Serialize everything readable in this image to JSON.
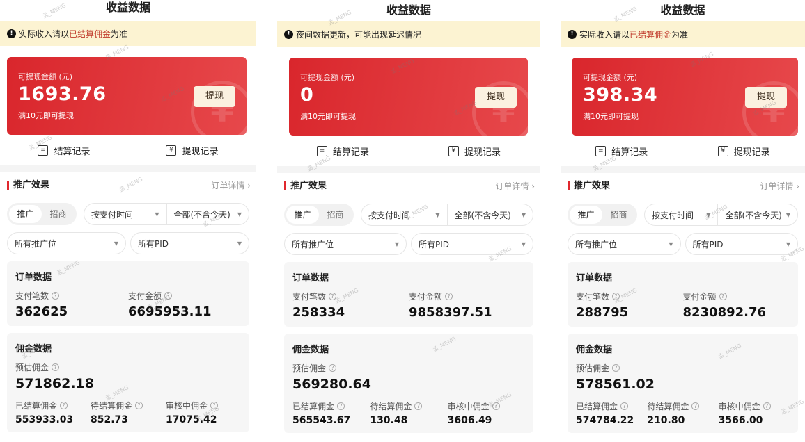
{
  "panels": [
    {
      "title": "收益数据",
      "notice": {
        "prefix": "实际收入请以",
        "highlight": "已结算佣金",
        "suffix": "为准"
      },
      "card": {
        "label": "可提现金额 (元)",
        "amount": "1693.76",
        "note": "满10元即可提现",
        "button": "提现"
      },
      "records": {
        "settle": "结算记录",
        "withdraw": "提现记录"
      },
      "section": {
        "title": "推广效果",
        "link": "订单详情 ›"
      },
      "segments": {
        "promote": "推广",
        "merchant": "招商"
      },
      "time_filter": "按支付时间",
      "range_filter": "全部(不含今天)",
      "position_filter": "所有推广位",
      "pid_filter": "所有PID",
      "orders": {
        "title": "订单数据",
        "count_label": "支付笔数",
        "count": "362625",
        "amount_label": "支付金额",
        "amount": "6695953.11"
      },
      "commission": {
        "title": "佣金数据",
        "est_label": "预估佣金",
        "est": "571862.18",
        "settled_label": "已结算佣金",
        "settled": "553933.03",
        "pending_label": "待结算佣金",
        "pending": "852.73",
        "review_label": "审核中佣金",
        "review": "17075.42"
      }
    },
    {
      "title": "收益数据",
      "notice": {
        "prefix": "夜间数据更新，可能出现延迟情况",
        "highlight": "",
        "suffix": ""
      },
      "card": {
        "label": "可提现金额 (元)",
        "amount": "0",
        "note": "满10元即可提现",
        "button": "提现"
      },
      "records": {
        "settle": "结算记录",
        "withdraw": "提现记录"
      },
      "section": {
        "title": "推广效果",
        "link": "订单详情 ›"
      },
      "segments": {
        "promote": "推广",
        "merchant": "招商"
      },
      "time_filter": "按支付时间",
      "range_filter": "全部(不含今天)",
      "position_filter": "所有推广位",
      "pid_filter": "所有PID",
      "orders": {
        "title": "订单数据",
        "count_label": "支付笔数",
        "count": "258334",
        "amount_label": "支付金额",
        "amount": "9858397.51"
      },
      "commission": {
        "title": "佣金数据",
        "est_label": "预估佣金",
        "est": "569280.64",
        "settled_label": "已结算佣金",
        "settled": "565543.67",
        "pending_label": "待结算佣金",
        "pending": "130.48",
        "review_label": "审核中佣金",
        "review": "3606.49"
      }
    },
    {
      "title": "收益数据",
      "notice": {
        "prefix": "实际收入请以",
        "highlight": "已结算佣金",
        "suffix": "为准"
      },
      "card": {
        "label": "可提现金额 (元)",
        "amount": "398.34",
        "note": "满10元即可提现",
        "button": "提现"
      },
      "records": {
        "settle": "结算记录",
        "withdraw": "提现记录"
      },
      "section": {
        "title": "推广效果",
        "link": "订单详情 ›"
      },
      "segments": {
        "promote": "推广",
        "merchant": "招商"
      },
      "time_filter": "按支付时间",
      "range_filter": "全部(不含今天)",
      "position_filter": "所有推广位",
      "pid_filter": "所有PID",
      "orders": {
        "title": "订单数据",
        "count_label": "支付笔数",
        "count": "288795",
        "amount_label": "支付金额",
        "amount": "8230892.76"
      },
      "commission": {
        "title": "佣金数据",
        "est_label": "预估佣金",
        "est": "578561.02",
        "settled_label": "已结算佣金",
        "settled": "574784.22",
        "pending_label": "待结算佣金",
        "pending": "210.80",
        "review_label": "审核中佣金",
        "review": "3566.00"
      }
    }
  ],
  "watermark_text": "孟_MENG",
  "colors": {
    "brand_red": "#e0282e",
    "notice_bg": "#fcf3d2",
    "highlight": "#c0392b"
  }
}
